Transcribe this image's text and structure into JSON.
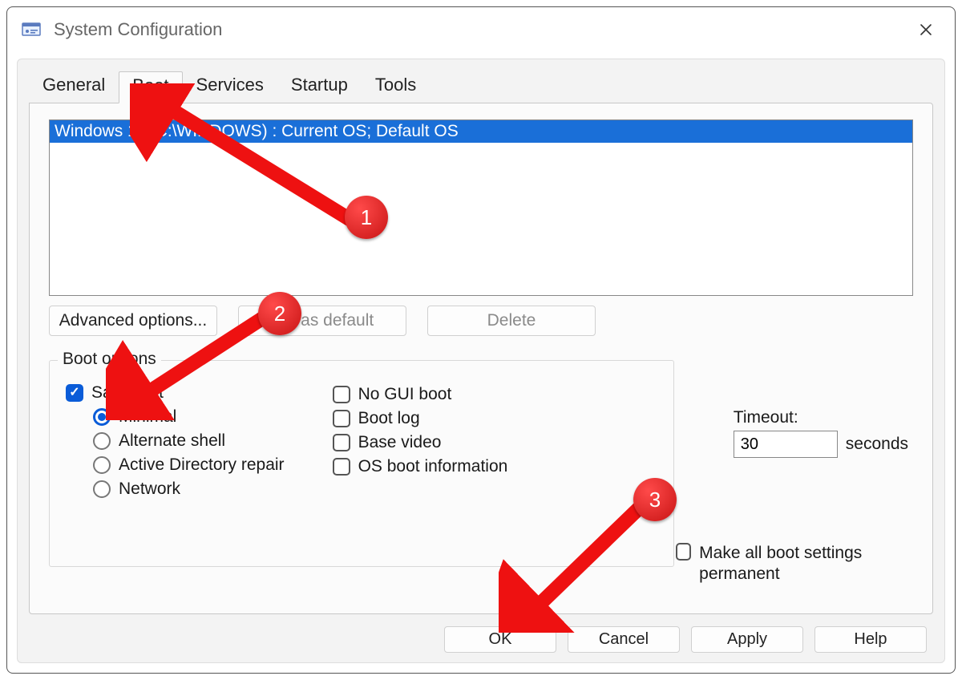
{
  "window": {
    "title": "System Configuration"
  },
  "tabs": {
    "general": "General",
    "boot": "Boot",
    "services": "Services",
    "startup": "Startup",
    "tools": "Tools",
    "active": "boot"
  },
  "os_list": {
    "entry": "Windows 11 (C:\\WINDOWS) : Current OS; Default OS"
  },
  "buttons": {
    "advanced": "Advanced options...",
    "set_default": "Set as default",
    "delete": "Delete",
    "ok": "OK",
    "cancel": "Cancel",
    "apply": "Apply",
    "help": "Help"
  },
  "boot_options": {
    "legend": "Boot options",
    "safe_boot": {
      "label": "Safe boot",
      "checked": true
    },
    "radios": {
      "minimal": "Minimal",
      "alternate": "Alternate shell",
      "ad_repair": "Active Directory repair",
      "network": "Network",
      "selected": "minimal"
    },
    "extra": {
      "no_gui": {
        "label": "No GUI boot",
        "checked": false
      },
      "boot_log": {
        "label": "Boot log",
        "checked": false
      },
      "base_video": {
        "label": "Base video",
        "checked": false
      },
      "os_info": {
        "label": "OS boot information",
        "checked": false
      }
    }
  },
  "timeout": {
    "label": "Timeout:",
    "value": "30",
    "unit": "seconds"
  },
  "permanent": {
    "label": "Make all boot settings permanent",
    "checked": false
  },
  "annotations": {
    "one": "1",
    "two": "2",
    "three": "3"
  }
}
